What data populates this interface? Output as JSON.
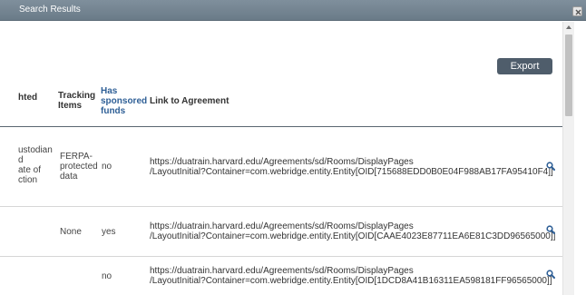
{
  "window": {
    "title": "Search Results"
  },
  "toolbar": {
    "export_label": "Export"
  },
  "table": {
    "headers": {
      "col_partial": "hted",
      "tracking_line1": "Tracking",
      "tracking_line2": "Items",
      "sponsored_line1": "Has",
      "sponsored_line2": "sponsored",
      "sponsored_line3": "funds",
      "link": "Link to Agreement"
    },
    "rows": [
      {
        "partial_lines": [
          "ustodian",
          "d",
          "ate of",
          "ction"
        ],
        "tracking_lines": [
          "FERPA-",
          "protected",
          "data"
        ],
        "sponsored": "no",
        "link_line1": "https://duatrain.harvard.edu/Agreements/sd/Rooms/DisplayPages",
        "link_line2": "/LayoutInitial?Container=com.webridge.entity.Entity[OID[715688EDD0B0E04F988AB17FA95410F4]]"
      },
      {
        "partial_lines": [],
        "tracking_lines": [
          "None"
        ],
        "sponsored": "yes",
        "link_line1": "https://duatrain.harvard.edu/Agreements/sd/Rooms/DisplayPages",
        "link_line2": "/LayoutInitial?Container=com.webridge.entity.Entity[OID[CAAE4023E87711EA6E81C3DD96565000]]"
      },
      {
        "partial_lines": [],
        "tracking_lines": [],
        "sponsored": "no",
        "link_line1": "https://duatrain.harvard.edu/Agreements/sd/Rooms/DisplayPages",
        "link_line2": "/LayoutInitial?Container=com.webridge.entity.Entity[OID[1DCD8A41B16311EA598181FF96565000]]"
      }
    ]
  },
  "icons": {
    "close": "close-icon",
    "view": "magnifier-icon",
    "scroll_up": "chevron-up-icon"
  },
  "colors": {
    "titlebar": "#6a7b88",
    "export_button": "#4f5d6b",
    "header_link": "#2e5f96",
    "view_icon": "#2e5f96"
  }
}
